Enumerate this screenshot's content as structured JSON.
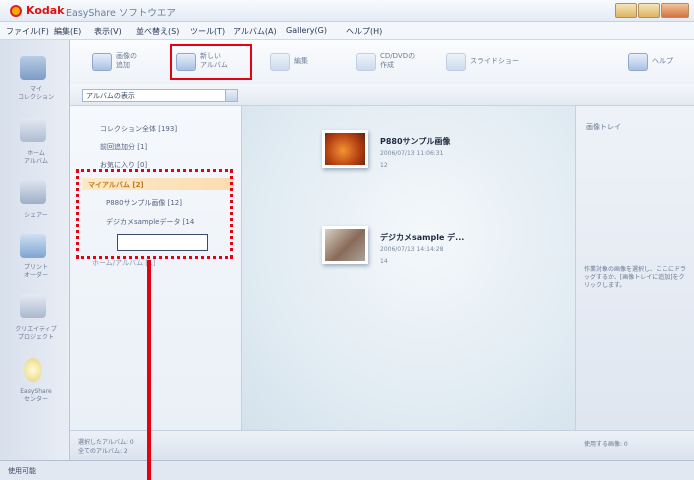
{
  "window": {
    "brand": "Kodak",
    "title": "EasyShare ソフトウエア"
  },
  "menu": [
    "ファイル(F)",
    "編集(E)",
    "表示(V)",
    "並べ替え(S)",
    "ツール(T)",
    "アルバム(A)",
    "Gallery(G)",
    "ヘルプ(H)"
  ],
  "toolbar": {
    "add_line1": "画像の",
    "add_line2": "追加",
    "new_album_line1": "新しい",
    "new_album_line2": "アルバム",
    "edit": "編集",
    "cd_line1": "CD/DVDの",
    "cd_line2": "作成",
    "slideshow": "スライドショー",
    "help": "ヘルプ"
  },
  "left_strip": {
    "my_collection_line1": "マイ",
    "my_collection_line2": "コレクション",
    "home_album_line1": "ホーム",
    "home_album_line2": "アルバム",
    "share": "シェアー",
    "print_order_line1": "プリント",
    "print_order_line2": "オーダー",
    "creative_line1": "クリエイティブ",
    "creative_line2": "プロジェクト",
    "center_line1": "EasyShare",
    "center_line2": "センター"
  },
  "view_select": {
    "value": "アルバムの表示"
  },
  "tree": {
    "collection_all": "コレクション全体 [193]",
    "recent": "前回追加分 [1]",
    "favorites": "お気に入り [0]",
    "my_albums": "マイアルバム [2]",
    "album1": "P880サンプル画像 [12]",
    "album2": "デジカメsampleデータ [14",
    "other": "ホーム/アルバム [1]",
    "new_album_name": ""
  },
  "albums": [
    {
      "title": "P880サンプル画像",
      "date": "2006/07/13 11:06:31",
      "count": "12"
    },
    {
      "title": "デジカメsample デ...",
      "date": "2006/07/13 14:14:28",
      "count": "14"
    }
  ],
  "right_panel": {
    "title": "画像トレイ",
    "hint": "作業対象の画像を選択し、ここにドラッグするか、[画像トレイに追加]をクリックします。",
    "footer": "使用する画像: 0"
  },
  "footer": {
    "selected_albums": "選択したアルバム: 0",
    "total_albums": "全てのアルバム: 2"
  },
  "status": {
    "text": "使用可能"
  }
}
